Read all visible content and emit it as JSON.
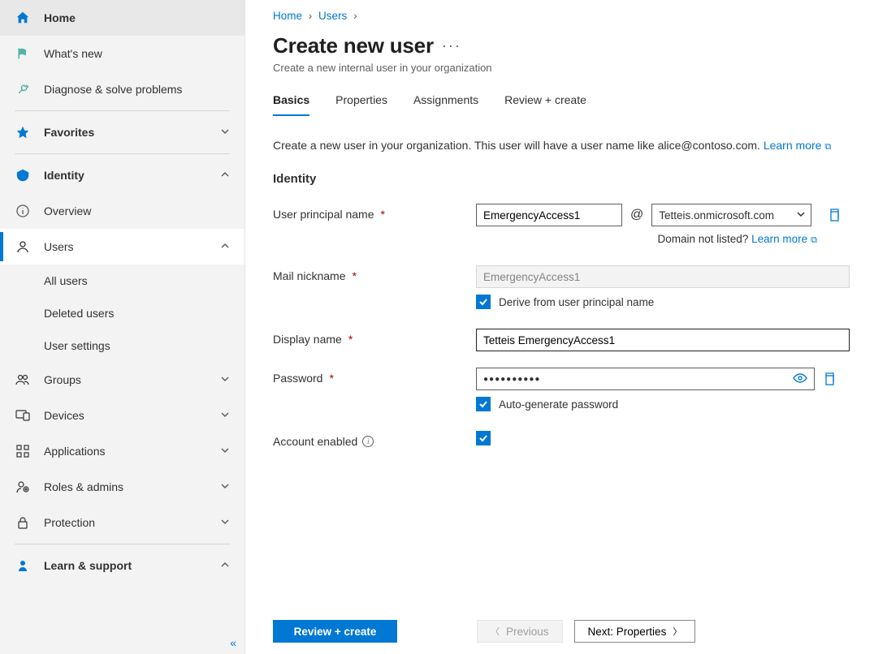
{
  "sidebar": {
    "home": "Home",
    "whats_new": "What's new",
    "diagnose": "Diagnose & solve problems",
    "favorites": "Favorites",
    "identity": "Identity",
    "overview": "Overview",
    "users": "Users",
    "all_users": "All users",
    "deleted_users": "Deleted users",
    "user_settings": "User settings",
    "groups": "Groups",
    "devices": "Devices",
    "applications": "Applications",
    "roles": "Roles & admins",
    "protection": "Protection",
    "learn": "Learn & support"
  },
  "breadcrumb": {
    "home": "Home",
    "users": "Users"
  },
  "page": {
    "title": "Create new user",
    "subtitle": "Create a new internal user in your organization"
  },
  "tabs": {
    "basics": "Basics",
    "properties": "Properties",
    "assignments": "Assignments",
    "review": "Review + create"
  },
  "intro": {
    "text": "Create a new user in your organization. This user will have a user name like alice@contoso.com.",
    "learn": "Learn more"
  },
  "section": {
    "identity": "Identity"
  },
  "labels": {
    "upn": "User principal name",
    "mail_nick": "Mail nickname",
    "display_name": "Display name",
    "password": "Password",
    "account_enabled": "Account enabled"
  },
  "fields": {
    "upn_user": "EmergencyAccess1",
    "upn_domain": "Tetteis.onmicrosoft.com",
    "mail_nick": "EmergencyAccess1",
    "display_name": "Tetteis EmergencyAccess1",
    "password_mask": "●●●●●●●●●●"
  },
  "aux": {
    "domain_not_listed": "Domain not listed?",
    "learn_more": "Learn more",
    "derive": "Derive from user principal name",
    "auto_gen": "Auto-generate password"
  },
  "footer": {
    "review": "Review + create",
    "previous": "Previous",
    "next": "Next: Properties"
  },
  "glyphs": {
    "at": "@"
  }
}
